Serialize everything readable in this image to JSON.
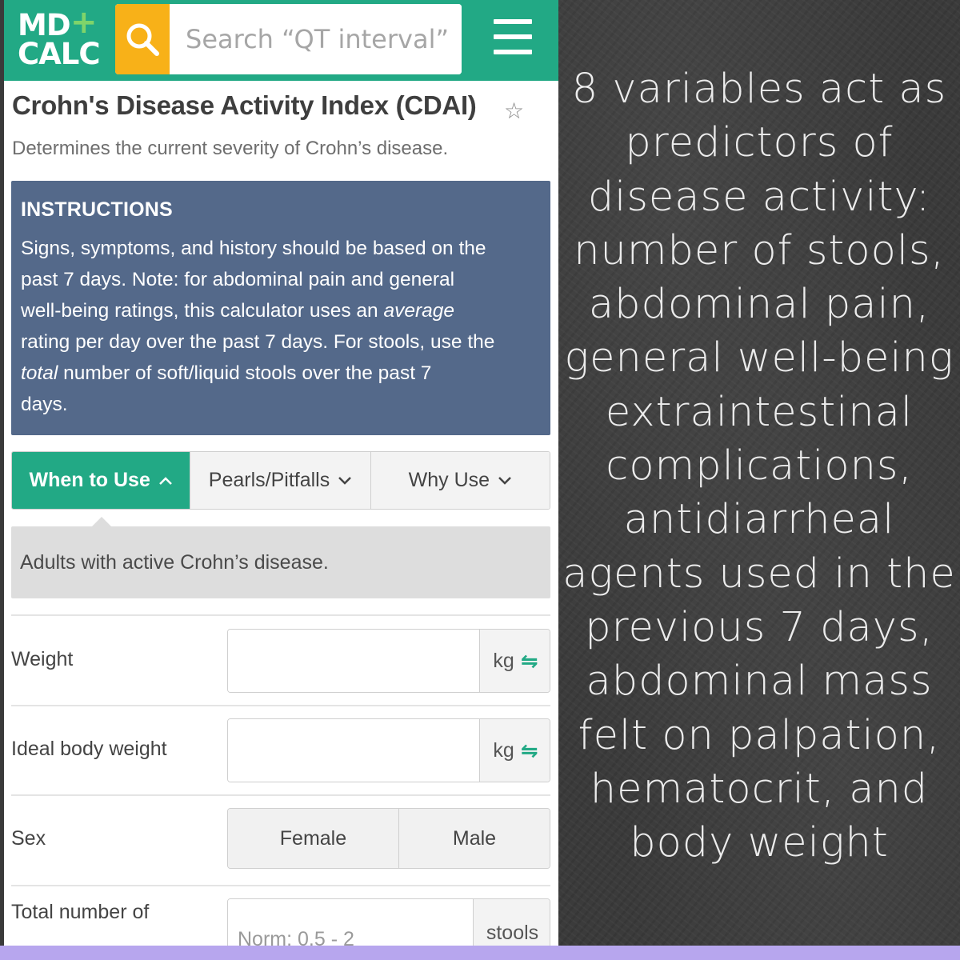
{
  "header": {
    "logo_line1": "MD",
    "logo_plus": "+",
    "logo_line2": "CALC",
    "search_placeholder": "Search “QT interval”",
    "search_icon": "search-icon",
    "menu_icon": "hamburger-menu-icon",
    "brand_color": "#22a985",
    "search_button_color": "#f8b118"
  },
  "calculator": {
    "title": "Crohn's Disease Activity Index (CDAI)",
    "favorite_icon": "☆",
    "subtitle": "Determines the current severity of Crohn’s disease."
  },
  "instructions": {
    "heading": "INSTRUCTIONS",
    "line1": "Signs, symptoms, and history should be based on the",
    "line2": "past 7 days. Note: for abdominal pain and general",
    "line3_pre": "well-being ratings, this calculator uses an ",
    "line3_em": "average",
    "line4": "rating per day over the past 7 days. For stools, use the",
    "line5_em": "total",
    "line5_post": " number of soft/liquid stools over the past 7",
    "line6": "days.",
    "background_color": "#54698a"
  },
  "tabs": [
    {
      "label": "When to Use",
      "chevron": "^",
      "active": true
    },
    {
      "label": "Pearls/Pitfalls",
      "chevron": "⌄",
      "active": false
    },
    {
      "label": "Why Use",
      "chevron": "⌄",
      "active": false
    }
  ],
  "when_to_use_text": "Adults with active Crohn’s disease.",
  "form": {
    "weight": {
      "label": "Weight",
      "value": "",
      "unit": "kg",
      "swap_icon": "⇋"
    },
    "ideal_weight": {
      "label": "Ideal body weight",
      "value": "",
      "unit": "kg",
      "swap_icon": "⇋"
    },
    "sex": {
      "label": "Sex",
      "options": [
        "Female",
        "Male"
      ]
    },
    "stools": {
      "label": "Total number of",
      "placeholder": "Norm: 0.5 - 2",
      "unit": "stools"
    }
  },
  "board": {
    "lines": [
      "8 variables act as",
      "predictors of",
      "disease activity:",
      "number of stools,",
      "abdominal pain,",
      "general well-being",
      "extraintestinal",
      "complications,",
      "antidiarrheal",
      "agents used in the",
      "previous 7 days,",
      "abdominal mass",
      "felt on palpation,",
      "hematocrit, and",
      "body weight"
    ]
  },
  "bottom_strip_color": "#b7a6ee"
}
